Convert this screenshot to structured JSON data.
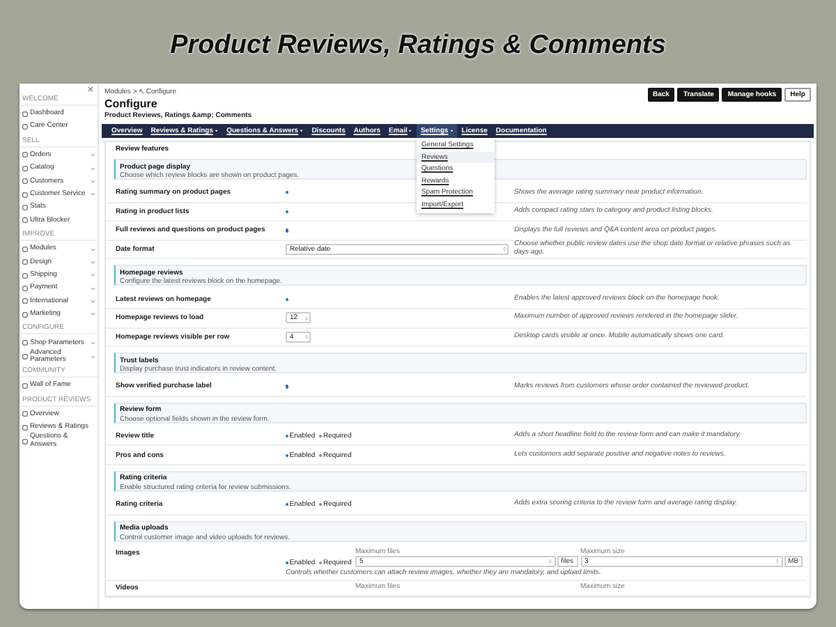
{
  "banner_title": "Product Reviews, Ratings & Comments",
  "sidebar": {
    "groups": [
      {
        "heading": "WELCOME",
        "items": [
          {
            "label": "Dashboard",
            "expandable": false
          },
          {
            "label": "Care Center",
            "expandable": false
          }
        ]
      },
      {
        "heading": "SELL",
        "items": [
          {
            "label": "Orders",
            "expandable": true
          },
          {
            "label": "Catalog",
            "expandable": true
          },
          {
            "label": "Customers",
            "expandable": true
          },
          {
            "label": "Customer Service",
            "expandable": true
          },
          {
            "label": "Stats",
            "expandable": false
          },
          {
            "label": "Ultra Blocker",
            "expandable": false
          }
        ]
      },
      {
        "heading": "IMPROVE",
        "items": [
          {
            "label": "Modules",
            "expandable": true
          },
          {
            "label": "Design",
            "expandable": true
          },
          {
            "label": "Shipping",
            "expandable": true
          },
          {
            "label": "Payment",
            "expandable": true
          },
          {
            "label": "International",
            "expandable": true
          },
          {
            "label": "Marketing",
            "expandable": true
          }
        ]
      },
      {
        "heading": "CONFIGURE",
        "items": [
          {
            "label": "Shop Parameters",
            "expandable": true
          },
          {
            "label": "Advanced Parameters",
            "expandable": true
          }
        ]
      },
      {
        "heading": "COMMUNITY",
        "items": [
          {
            "label": "Wall of Fame",
            "expandable": false
          }
        ]
      },
      {
        "heading": "PRODUCT REVIEWS",
        "items": [
          {
            "label": "Overview",
            "expandable": false
          },
          {
            "label": "Reviews & Ratings",
            "expandable": false
          },
          {
            "label": "Questions & Answers",
            "expandable": false
          }
        ]
      }
    ]
  },
  "breadcrumb": [
    "Modules",
    "Configure"
  ],
  "breadcrumb_separator": ">",
  "title": "Configure",
  "subtitle": "Product Reviews, Ratings &amp; Comments",
  "header_buttons": [
    {
      "label": "Back",
      "kind": "dark"
    },
    {
      "label": "Translate",
      "kind": "dark"
    },
    {
      "label": "Manage hooks",
      "kind": "dark"
    },
    {
      "label": "Help",
      "kind": "light"
    }
  ],
  "nav": [
    {
      "label": "Overview",
      "caret": false,
      "selected": false
    },
    {
      "label": "Reviews & Ratings",
      "caret": true,
      "selected": false
    },
    {
      "label": "Questions & Answers",
      "caret": true,
      "selected": false
    },
    {
      "label": "Discounts",
      "caret": false,
      "selected": false
    },
    {
      "label": "Authors",
      "caret": false,
      "selected": false
    },
    {
      "label": "Email",
      "caret": true,
      "selected": false
    },
    {
      "label": "Settings",
      "caret": true,
      "selected": true,
      "expanded": true,
      "menu": [
        {
          "label": "General Settings",
          "selected": false
        },
        {
          "label": "Reviews",
          "selected": true
        },
        {
          "label": "Questions",
          "selected": false
        },
        {
          "label": "Rewards",
          "selected": false
        },
        {
          "label": "Spam Protection",
          "selected": false
        },
        {
          "label": "Import/Export",
          "selected": false
        }
      ]
    },
    {
      "label": "License",
      "caret": false,
      "selected": false
    },
    {
      "label": "Documentation",
      "caret": false,
      "selected": false
    }
  ],
  "panel": {
    "heading": "Review features",
    "sections": [
      {
        "title": "Product page display",
        "subtitle": "Choose which review blocks are shown on product pages.",
        "rows": [
          {
            "kind": "toggle",
            "label": "Rating summary on product pages",
            "on": true,
            "description": "Shows the average rating summary near product information."
          },
          {
            "kind": "toggle",
            "label": "Rating in product lists",
            "on": true,
            "description": "Adds compact rating stars to category and product listing blocks."
          },
          {
            "kind": "toggle",
            "label": "Full reviews and questions on product pages",
            "on": true,
            "description": "Displays the full reviews and Q&A content area on product pages."
          },
          {
            "kind": "select",
            "label": "Date format",
            "value": "Relative date",
            "description": "Choose whether public review dates use the shop date format or relative phrases such as days ago."
          }
        ]
      },
      {
        "title": "Homepage reviews",
        "subtitle": "Configure the latest reviews block on the homepage.",
        "rows": [
          {
            "kind": "toggle",
            "label": "Latest reviews on homepage",
            "on": true,
            "description": "Enables the latest approved reviews block on the homepage hook."
          },
          {
            "kind": "number",
            "label": "Homepage reviews to load",
            "value": "12",
            "description": "Maximum number of approved reviews rendered in the homepage slider."
          },
          {
            "kind": "number",
            "label": "Homepage reviews visible per row",
            "value": "4",
            "description": "Desktop cards visible at once. Mobile automatically shows one card."
          }
        ]
      },
      {
        "title": "Trust labels",
        "subtitle": "Display purchase trust indicators in review content.",
        "rows": [
          {
            "kind": "toggle",
            "label": "Show verified purchase label",
            "on": true,
            "description": "Marks reviews from customers whose order contained the reviewed product."
          }
        ]
      },
      {
        "title": "Review form",
        "subtitle": "Choose optional fields shown in the review form.",
        "rows": [
          {
            "kind": "options",
            "label": "Review title",
            "options": [
              {
                "label": "Enabled",
                "checked": true
              },
              {
                "label": "Required",
                "checked": false
              }
            ],
            "description": "Adds a short headline field to the review form and can make it mandatory."
          },
          {
            "kind": "options",
            "label": "Pros and cons",
            "options": [
              {
                "label": "Enabled",
                "checked": true
              },
              {
                "label": "Required",
                "checked": false
              }
            ],
            "description": "Lets customers add separate positive and negative notes to reviews."
          }
        ]
      },
      {
        "title": "Rating criteria",
        "subtitle": "Enable structured rating criteria for review submissions.",
        "rows": [
          {
            "kind": "options",
            "label": "Rating criteria",
            "options": [
              {
                "label": "Enabled",
                "checked": true
              },
              {
                "label": "Required",
                "checked": false
              }
            ],
            "description": "Adds extra scoring criteria to the review form and average rating display."
          }
        ]
      },
      {
        "title": "Media uploads",
        "subtitle": "Control customer image and video uploads for reviews.",
        "rows": [
          {
            "kind": "media",
            "label": "Images",
            "options": [
              {
                "label": "Enabled",
                "checked": true
              },
              {
                "label": "Required",
                "checked": false
              }
            ],
            "fields": [
              {
                "label": "Maximum files",
                "value": "5",
                "unit": "files"
              },
              {
                "label": "Maximum size",
                "value": "3",
                "unit": "MB"
              }
            ],
            "description": "Controls whether customers can attach review images, whether they are mandatory, and upload limits."
          },
          {
            "kind": "media",
            "label": "Videos",
            "fields": [
              {
                "label": "Maximum files"
              },
              {
                "label": "Maximum size"
              }
            ]
          }
        ]
      }
    ]
  }
}
